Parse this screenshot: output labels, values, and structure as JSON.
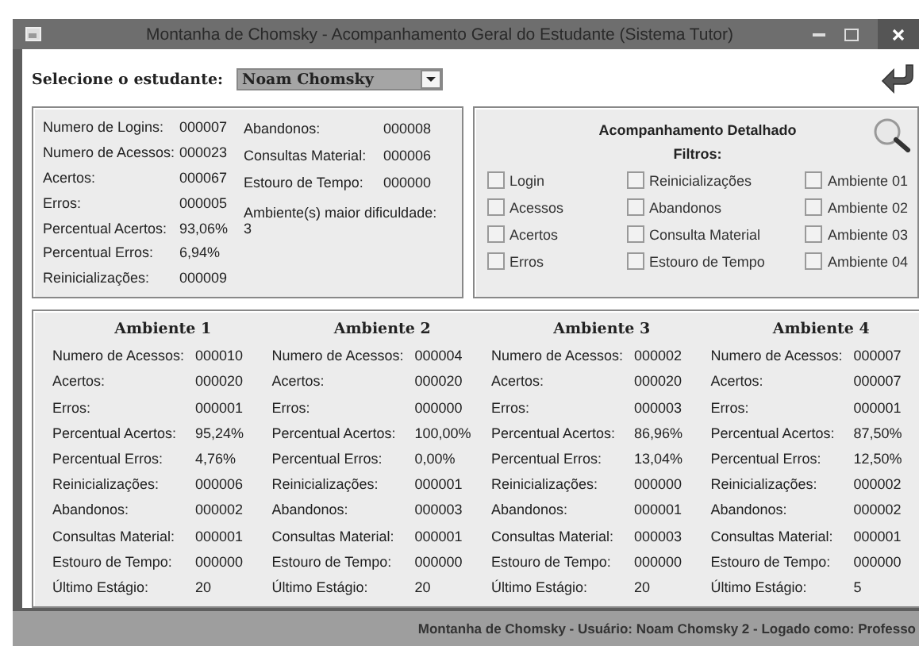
{
  "window": {
    "title": "Montanha de Chomsky - Acompanhamento Geral do Estudante (Sistema Tutor)"
  },
  "student": {
    "label": "Selecione o estudante:",
    "value": "Noam Chomsky"
  },
  "summary": {
    "left": [
      {
        "label": "Numero de Logins:",
        "value": "000007"
      },
      {
        "label": "Numero de Acessos:",
        "value": "000023"
      },
      {
        "label": "Acertos:",
        "value": "000067"
      },
      {
        "label": "Erros:",
        "value": "000005"
      },
      {
        "label": "Percentual Acertos:",
        "value": "93,06%"
      },
      {
        "label": "Percentual Erros:",
        "value": "6,94%"
      },
      {
        "label": "Reinicializações:",
        "value": "000009"
      }
    ],
    "right": [
      {
        "label": "Abandonos:",
        "value": "000008"
      },
      {
        "label": "Consultas Material:",
        "value": "000006"
      },
      {
        "label": "Estouro de Tempo:",
        "value": "000000"
      }
    ],
    "difficulty": {
      "label": "Ambiente(s) maior dificuldade:",
      "value": "3"
    }
  },
  "detail": {
    "title": "Acompanhamento Detalhado",
    "filters_label": "Filtros:",
    "filters": [
      [
        {
          "label": "Login",
          "checked": false
        },
        {
          "label": "Acessos",
          "checked": false
        },
        {
          "label": "Acertos",
          "checked": false
        },
        {
          "label": "Erros",
          "checked": false
        }
      ],
      [
        {
          "label": "Reinicializações",
          "checked": false
        },
        {
          "label": "Abandonos",
          "checked": false
        },
        {
          "label": "Consulta Material",
          "checked": false
        },
        {
          "label": "Estouro de Tempo",
          "checked": false
        }
      ],
      [
        {
          "label": "Ambiente 01",
          "checked": false
        },
        {
          "label": "Ambiente 02",
          "checked": false
        },
        {
          "label": "Ambiente 03",
          "checked": false
        },
        {
          "label": "Ambiente 04",
          "checked": false
        }
      ]
    ]
  },
  "environments": [
    {
      "title": "Ambiente 1",
      "rows": [
        [
          "Numero de Acessos:",
          "000010"
        ],
        [
          "Acertos:",
          "000020"
        ],
        [
          "Erros:",
          "000001"
        ],
        [
          "Percentual Acertos:",
          "95,24%"
        ],
        [
          "Percentual Erros:",
          "4,76%"
        ],
        [
          "Reinicializações:",
          "000006"
        ],
        [
          "Abandonos:",
          "000002"
        ],
        [
          "Consultas Material:",
          "000001"
        ],
        [
          "Estouro de Tempo:",
          "000000"
        ],
        [
          "Último Estágio:",
          "20"
        ]
      ]
    },
    {
      "title": "Ambiente 2",
      "rows": [
        [
          "Numero de Acessos:",
          "000004"
        ],
        [
          "Acertos:",
          "000020"
        ],
        [
          "Erros:",
          "000000"
        ],
        [
          "Percentual Acertos:",
          "100,00%"
        ],
        [
          "Percentual Erros:",
          "0,00%"
        ],
        [
          "Reinicializações:",
          "000001"
        ],
        [
          "Abandonos:",
          "000003"
        ],
        [
          "Consultas Material:",
          "000001"
        ],
        [
          "Estouro de Tempo:",
          "000000"
        ],
        [
          "Último Estágio:",
          "20"
        ]
      ]
    },
    {
      "title": "Ambiente 3",
      "rows": [
        [
          "Numero de Acessos:",
          "000002"
        ],
        [
          "Acertos:",
          "000020"
        ],
        [
          "Erros:",
          "000003"
        ],
        [
          "Percentual Acertos:",
          "86,96%"
        ],
        [
          "Percentual Erros:",
          "13,04%"
        ],
        [
          "Reinicializações:",
          "000000"
        ],
        [
          "Abandonos:",
          "000001"
        ],
        [
          "Consultas Material:",
          "000003"
        ],
        [
          "Estouro de Tempo:",
          "000000"
        ],
        [
          "Último Estágio:",
          "20"
        ]
      ]
    },
    {
      "title": "Ambiente 4",
      "rows": [
        [
          "Numero de Acessos:",
          "000007"
        ],
        [
          "Acertos:",
          "000007"
        ],
        [
          "Erros:",
          "000001"
        ],
        [
          "Percentual Acertos:",
          "87,50%"
        ],
        [
          "Percentual Erros:",
          "12,50%"
        ],
        [
          "Reinicializações:",
          "000002"
        ],
        [
          "Abandonos:",
          "000002"
        ],
        [
          "Consultas Material:",
          "000001"
        ],
        [
          "Estouro de Tempo:",
          "000000"
        ],
        [
          "Último Estágio:",
          "5"
        ]
      ]
    }
  ],
  "status_bar": "Montanha de Chomsky - Usuário: Noam Chomsky 2 - Logado como: Professo"
}
